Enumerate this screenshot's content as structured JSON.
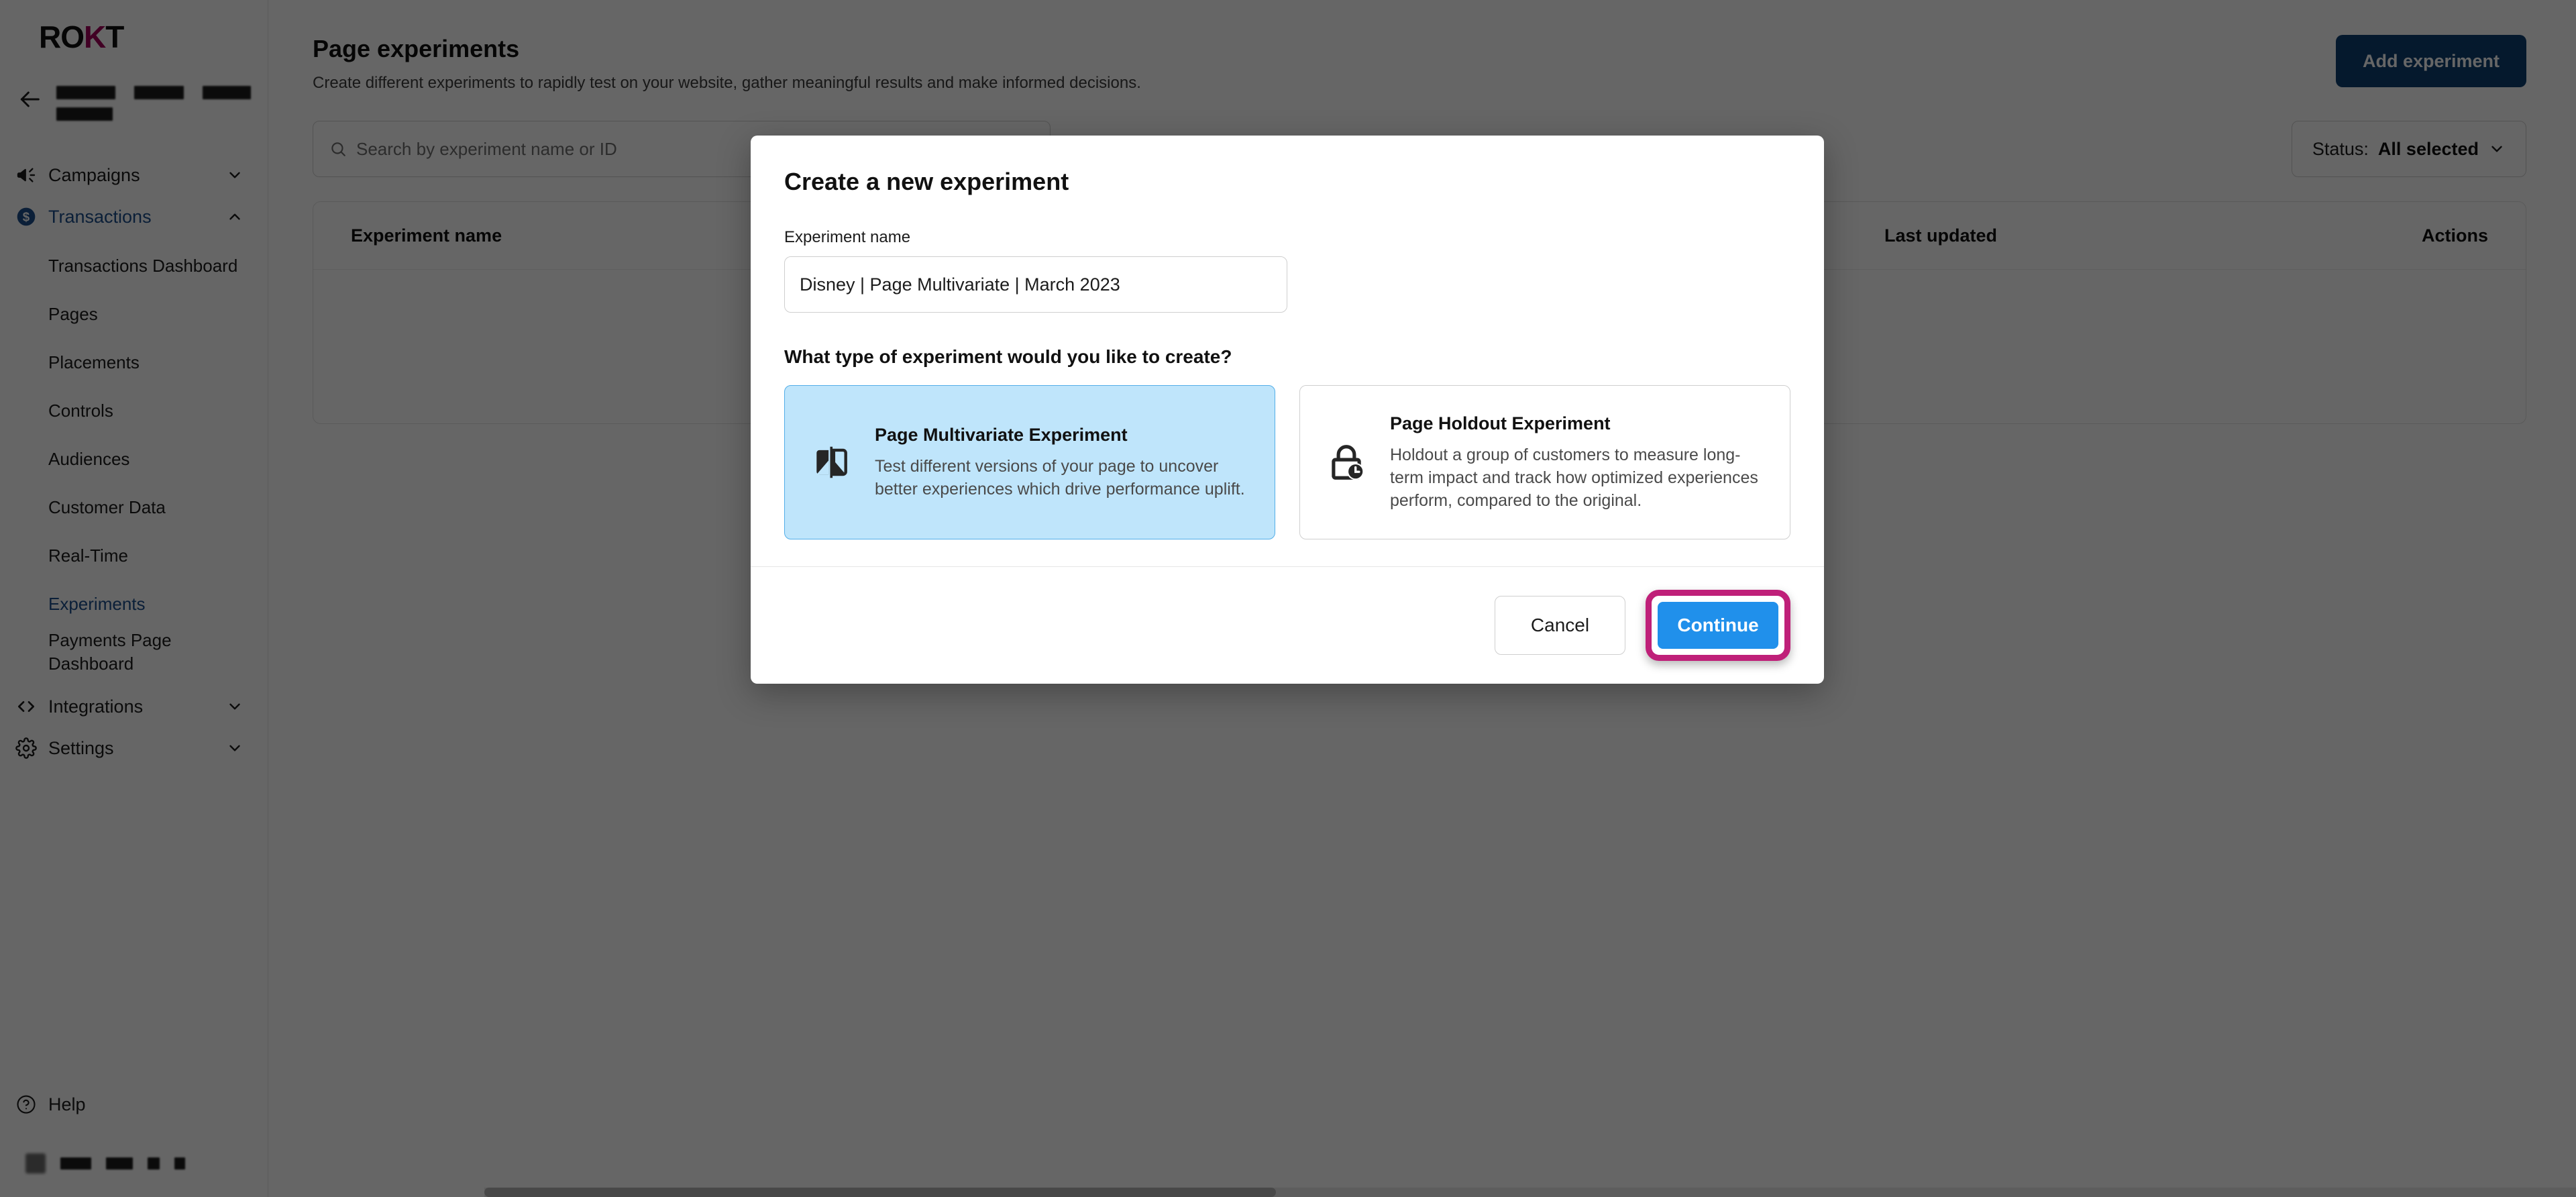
{
  "sidebar": {
    "brand": {
      "text_left": "RO",
      "text_accent": "K",
      "text_right": "T"
    },
    "back_icon": "arrow-left-icon",
    "account_redacted": true,
    "groups": [
      {
        "label": "Campaigns",
        "icon": "megaphone-icon",
        "chevron": "chevron-down-icon",
        "expanded": false,
        "active": false,
        "items": []
      },
      {
        "label": "Transactions",
        "icon": "dollar-circle-icon",
        "chevron": "chevron-up-icon",
        "expanded": true,
        "active": true,
        "items": [
          {
            "label": "Transactions Dashboard",
            "active": false
          },
          {
            "label": "Pages",
            "active": false
          },
          {
            "label": "Placements",
            "active": false
          },
          {
            "label": "Controls",
            "active": false
          },
          {
            "label": "Audiences",
            "active": false
          },
          {
            "label": "Customer Data",
            "active": false
          },
          {
            "label": "Real-Time",
            "active": false
          },
          {
            "label": "Experiments",
            "active": true
          },
          {
            "label": "Payments Page Dashboard",
            "active": false
          }
        ]
      },
      {
        "label": "Integrations",
        "icon": "code-brackets-icon",
        "chevron": "chevron-down-icon",
        "expanded": false,
        "active": false,
        "items": []
      },
      {
        "label": "Settings",
        "icon": "gear-icon",
        "chevron": "chevron-down-icon",
        "expanded": false,
        "active": false,
        "items": []
      }
    ],
    "help": {
      "label": "Help",
      "icon": "question-circle-icon"
    }
  },
  "page": {
    "title": "Page experiments",
    "subtitle": "Create different experiments to rapidly test on your website, gather meaningful results and make informed decisions.",
    "add_button": "Add experiment"
  },
  "toolbar": {
    "search_placeholder": "Search by experiment name or ID",
    "search_value": "",
    "search_icon": "search-icon",
    "status_label": "Status:",
    "status_value": "All selected",
    "status_chevron": "chevron-down-icon"
  },
  "table": {
    "columns": [
      "Experiment name",
      "Last updated",
      "Actions"
    ],
    "rows": []
  },
  "modal": {
    "title": "Create a new experiment",
    "name_label": "Experiment name",
    "name_value": "Disney | Page Multivariate | March 2023",
    "name_placeholder": "",
    "question": "What type of experiment would you like to create?",
    "options": [
      {
        "title": "Page Multivariate Experiment",
        "description": "Test different versions of your page to uncover better experiences which drive performance uplift.",
        "icon": "ab-split-icon",
        "selected": true
      },
      {
        "title": "Page Holdout Experiment",
        "description": "Holdout a group of customers to measure long-term impact and track how optimized experiences perform, compared to the original.",
        "icon": "lock-clock-icon",
        "selected": false
      }
    ],
    "cancel_label": "Cancel",
    "continue_label": "Continue",
    "continue_highlighted": true
  },
  "colors": {
    "brand_accent": "#a4005a",
    "primary_dark_blue": "#0e3f72",
    "continue_blue": "#2090eb",
    "highlight_magenta": "#bf2079",
    "selected_card_bg": "#bfe5fb",
    "selected_card_border": "#53aee8",
    "active_nav_blue": "#1c4f8c",
    "scrim": "rgba(0,0,0,0.60)"
  }
}
